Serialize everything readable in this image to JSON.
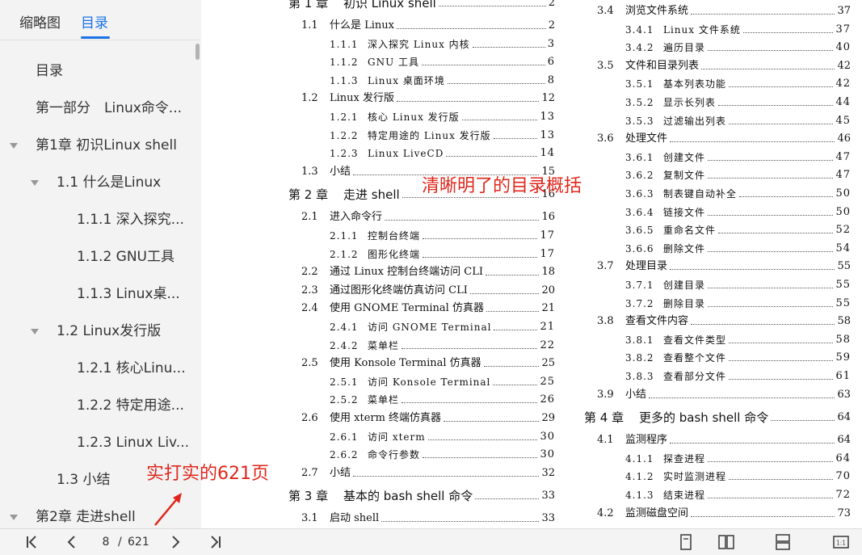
{
  "sidebar": {
    "tabs": {
      "thumbnails": "缩略图",
      "toc": "目录"
    },
    "items": [
      {
        "label": "目录",
        "level": 0
      },
      {
        "label": "第一部分　Linux命令...",
        "level": 0
      },
      {
        "label": "第1章 初识Linux shell",
        "level": 0,
        "expanded": true
      },
      {
        "label": "1.1 什么是Linux",
        "level": 1,
        "expanded": true
      },
      {
        "label": "1.1.1 深入探究...",
        "level": 2
      },
      {
        "label": "1.1.2 GNU工具",
        "level": 2
      },
      {
        "label": "1.1.3 Linux桌...",
        "level": 2
      },
      {
        "label": "1.2 Linux发行版",
        "level": 1,
        "expanded": true
      },
      {
        "label": "1.2.1 核心Linu...",
        "level": 2
      },
      {
        "label": "1.2.2 特定用途...",
        "level": 2
      },
      {
        "label": "1.2.3 Linux Liv...",
        "level": 2
      },
      {
        "label": "1.3 小结",
        "level": 1
      },
      {
        "label": "第2章 走进shell",
        "level": 0,
        "expanded": true
      }
    ]
  },
  "toc_left": [
    {
      "num": "第 1 章",
      "title": "初识 Linux shell",
      "page": "2",
      "kind": "chap"
    },
    {
      "num": "1.1",
      "title": "什么是 Linux",
      "page": "2",
      "kind": "sec"
    },
    {
      "num": "1.1.1",
      "title": "深入探究 Linux 内核",
      "page": "3",
      "kind": "sub"
    },
    {
      "num": "1.1.2",
      "title": "GNU 工具",
      "page": "6",
      "kind": "sub"
    },
    {
      "num": "1.1.3",
      "title": "Linux 桌面环境",
      "page": "8",
      "kind": "sub"
    },
    {
      "num": "1.2",
      "title": "Linux 发行版",
      "page": "12",
      "kind": "sec"
    },
    {
      "num": "1.2.1",
      "title": "核心 Linux 发行版",
      "page": "13",
      "kind": "sub"
    },
    {
      "num": "1.2.2",
      "title": "特定用途的 Linux 发行版",
      "page": "13",
      "kind": "sub"
    },
    {
      "num": "1.2.3",
      "title": "Linux LiveCD",
      "page": "14",
      "kind": "sub"
    },
    {
      "num": "1.3",
      "title": "小结",
      "page": "15",
      "kind": "sec"
    },
    {
      "num": "第 2 章",
      "title": "走进 shell",
      "page": "16",
      "kind": "chap"
    },
    {
      "num": "2.1",
      "title": "进入命令行",
      "page": "16",
      "kind": "sec"
    },
    {
      "num": "2.1.1",
      "title": "控制台终端",
      "page": "17",
      "kind": "sub"
    },
    {
      "num": "2.1.2",
      "title": "图形化终端",
      "page": "17",
      "kind": "sub"
    },
    {
      "num": "2.2",
      "title": "通过 Linux 控制台终端访问 CLI",
      "page": "18",
      "kind": "sec"
    },
    {
      "num": "2.3",
      "title": "通过图形化终端仿真访问 CLI",
      "page": "20",
      "kind": "sec"
    },
    {
      "num": "2.4",
      "title": "使用 GNOME Terminal 仿真器",
      "page": "21",
      "kind": "sec"
    },
    {
      "num": "2.4.1",
      "title": "访问 GNOME Terminal",
      "page": "21",
      "kind": "sub"
    },
    {
      "num": "2.4.2",
      "title": "菜单栏",
      "page": "22",
      "kind": "sub"
    },
    {
      "num": "2.5",
      "title": "使用 Konsole Terminal 仿真器",
      "page": "25",
      "kind": "sec"
    },
    {
      "num": "2.5.1",
      "title": "访问 Konsole Terminal",
      "page": "25",
      "kind": "sub"
    },
    {
      "num": "2.5.2",
      "title": "菜单栏",
      "page": "26",
      "kind": "sub"
    },
    {
      "num": "2.6",
      "title": "使用 xterm 终端仿真器",
      "page": "29",
      "kind": "sec"
    },
    {
      "num": "2.6.1",
      "title": "访问 xterm",
      "page": "30",
      "kind": "sub"
    },
    {
      "num": "2.6.2",
      "title": "命令行参数",
      "page": "30",
      "kind": "sub"
    },
    {
      "num": "2.7",
      "title": "小结",
      "page": "32",
      "kind": "sec"
    },
    {
      "num": "第 3 章",
      "title": "基本的 bash shell 命令",
      "page": "33",
      "kind": "chap"
    },
    {
      "num": "3.1",
      "title": "启动 shell",
      "page": "33",
      "kind": "sec"
    }
  ],
  "toc_right": [
    {
      "num": "3.4",
      "title": "浏览文件系统",
      "page": "37",
      "kind": "sec"
    },
    {
      "num": "3.4.1",
      "title": "Linux 文件系统",
      "page": "37",
      "kind": "sub"
    },
    {
      "num": "3.4.2",
      "title": "遍历目录",
      "page": "40",
      "kind": "sub"
    },
    {
      "num": "3.5",
      "title": "文件和目录列表",
      "page": "42",
      "kind": "sec"
    },
    {
      "num": "3.5.1",
      "title": "基本列表功能",
      "page": "42",
      "kind": "sub"
    },
    {
      "num": "3.5.2",
      "title": "显示长列表",
      "page": "44",
      "kind": "sub"
    },
    {
      "num": "3.5.3",
      "title": "过滤输出列表",
      "page": "45",
      "kind": "sub"
    },
    {
      "num": "3.6",
      "title": "处理文件",
      "page": "46",
      "kind": "sec"
    },
    {
      "num": "3.6.1",
      "title": "创建文件",
      "page": "47",
      "kind": "sub"
    },
    {
      "num": "3.6.2",
      "title": "复制文件",
      "page": "47",
      "kind": "sub"
    },
    {
      "num": "3.6.3",
      "title": "制表键自动补全",
      "page": "50",
      "kind": "sub"
    },
    {
      "num": "3.6.4",
      "title": "链接文件",
      "page": "50",
      "kind": "sub"
    },
    {
      "num": "3.6.5",
      "title": "重命名文件",
      "page": "52",
      "kind": "sub"
    },
    {
      "num": "3.6.6",
      "title": "删除文件",
      "page": "54",
      "kind": "sub"
    },
    {
      "num": "3.7",
      "title": "处理目录",
      "page": "55",
      "kind": "sec"
    },
    {
      "num": "3.7.1",
      "title": "创建目录",
      "page": "55",
      "kind": "sub"
    },
    {
      "num": "3.7.2",
      "title": "删除目录",
      "page": "55",
      "kind": "sub"
    },
    {
      "num": "3.8",
      "title": "查看文件内容",
      "page": "58",
      "kind": "sec"
    },
    {
      "num": "3.8.1",
      "title": "查看文件类型",
      "page": "58",
      "kind": "sub"
    },
    {
      "num": "3.8.2",
      "title": "查看整个文件",
      "page": "59",
      "kind": "sub"
    },
    {
      "num": "3.8.3",
      "title": "查看部分文件",
      "page": "61",
      "kind": "sub"
    },
    {
      "num": "3.9",
      "title": "小结",
      "page": "63",
      "kind": "sec"
    },
    {
      "num": "第 4 章",
      "title": "更多的 bash shell 命令",
      "page": "64",
      "kind": "chap"
    },
    {
      "num": "4.1",
      "title": "监测程序",
      "page": "64",
      "kind": "sec"
    },
    {
      "num": "4.1.1",
      "title": "探查进程",
      "page": "64",
      "kind": "sub"
    },
    {
      "num": "4.1.2",
      "title": "实时监测进程",
      "page": "70",
      "kind": "sub"
    },
    {
      "num": "4.1.3",
      "title": "结束进程",
      "page": "72",
      "kind": "sub"
    },
    {
      "num": "4.2",
      "title": "监测磁盘空间",
      "page": "73",
      "kind": "sec"
    }
  ],
  "annotations": {
    "toc_summary": "清晰明了的目录概括",
    "page_count": "实打实的621页"
  },
  "toolbar": {
    "current_page": "8",
    "slash": "/",
    "total_pages": "621"
  },
  "colors": {
    "accent": "#1a73e8",
    "annotation": "#e0261b",
    "sidebar_bg": "#f3f3f4"
  },
  "icons": [
    "first-page-icon",
    "prev-page-icon",
    "next-page-icon",
    "last-page-icon",
    "single-page-icon",
    "double-page-icon",
    "continuous-scroll-icon",
    "actual-size-icon"
  ]
}
